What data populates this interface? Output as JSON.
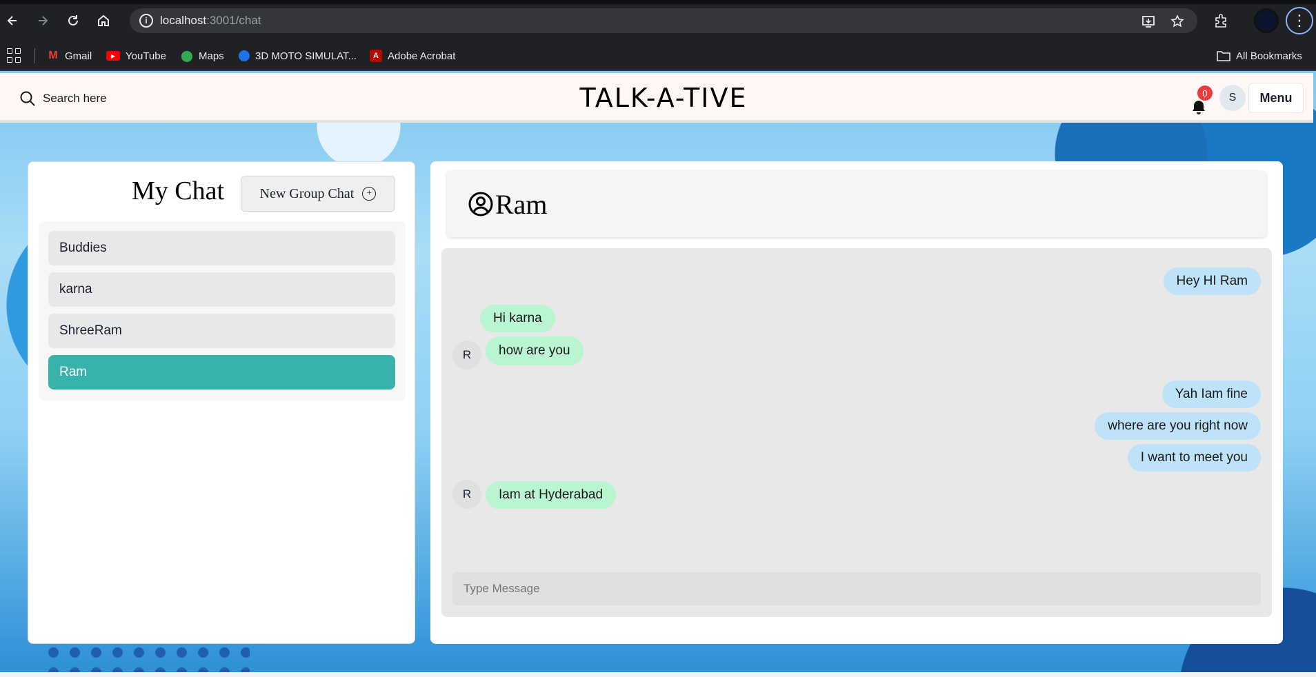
{
  "browser": {
    "url_host": "localhost",
    "url_path": ":3001/chat",
    "bookmarks": [
      {
        "label": "Gmail",
        "icon": "gmail-icon",
        "color": "#ea4335"
      },
      {
        "label": "YouTube",
        "icon": "youtube-icon",
        "color": "#ff0000"
      },
      {
        "label": "Maps",
        "icon": "maps-icon",
        "color": "#34a853"
      },
      {
        "label": "3D MOTO SIMULAT...",
        "icon": "globe-icon",
        "color": "#1a73e8"
      },
      {
        "label": "Adobe Acrobat",
        "icon": "acrobat-icon",
        "color": "#b30b00"
      }
    ],
    "all_bookmarks": "All Bookmarks"
  },
  "header": {
    "search_label": "Search here",
    "brand": "TALK-A-TIVE",
    "notification_count": "0",
    "user_initial": "S",
    "menu_label": "Menu"
  },
  "sidebar": {
    "title": "My Chat",
    "new_group_label": "New Group Chat",
    "chats": [
      {
        "name": "Buddies",
        "active": false
      },
      {
        "name": "karna",
        "active": false
      },
      {
        "name": "ShreeRam",
        "active": false
      },
      {
        "name": "Ram",
        "active": true
      }
    ]
  },
  "chat": {
    "title": "Ram",
    "sender_initial": "R",
    "messages": [
      {
        "text": "Hey HI Ram",
        "direction": "out"
      },
      {
        "text": "Hi karna",
        "direction": "in"
      },
      {
        "text": "how are you",
        "direction": "in"
      },
      {
        "text": "Yah Iam fine",
        "direction": "out"
      },
      {
        "text": "where are you right now",
        "direction": "out"
      },
      {
        "text": "I want to meet you",
        "direction": "out"
      },
      {
        "text": "Iam at Hyderabad",
        "direction": "in"
      }
    ],
    "input_placeholder": "Type Message"
  },
  "colors": {
    "accent_active_chat": "#38b2ac",
    "outgoing_bubble": "#bee3f8",
    "incoming_bubble": "#b9f5d0",
    "badge": "#e53e3e"
  }
}
